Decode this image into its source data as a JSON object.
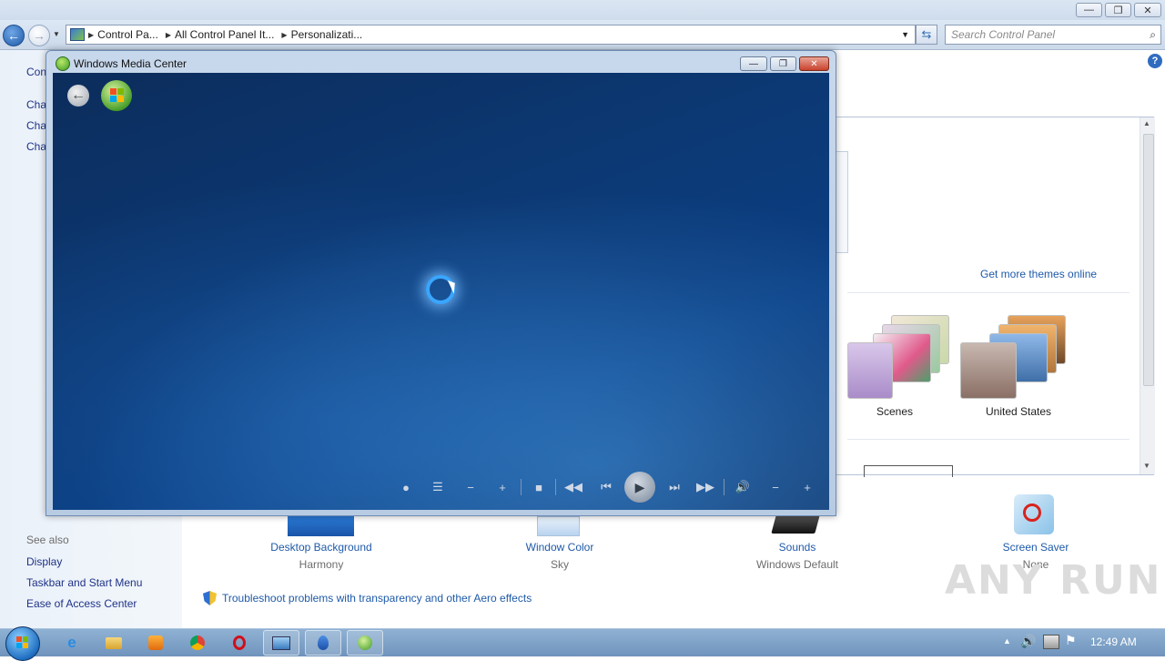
{
  "explorer": {
    "breadcrumb": [
      "Control Pa...",
      "All Control Panel It...",
      "Personalizati..."
    ],
    "search_placeholder": "Search Control Panel"
  },
  "left_pane": {
    "items_partial": [
      "Con",
      "Cha",
      "Cha",
      "Cha"
    ],
    "see_also_label": "See also",
    "see_also": [
      "Display",
      "Taskbar and Start Menu",
      "Ease of Access Center"
    ]
  },
  "themes": {
    "get_more_link": "Get more themes online",
    "items": [
      {
        "label": "Scenes"
      },
      {
        "label": "United States"
      }
    ]
  },
  "bottom_items": [
    {
      "title": "Desktop Background",
      "value": "Harmony"
    },
    {
      "title": "Window Color",
      "value": "Sky"
    },
    {
      "title": "Sounds",
      "value": "Windows Default"
    },
    {
      "title": "Screen Saver",
      "value": "None"
    }
  ],
  "troubleshoot_link": "Troubleshoot problems with transparency and other Aero effects",
  "wmc": {
    "title": "Windows Media Center"
  },
  "taskbar": {
    "clock": "12:49 AM"
  },
  "watermark": "ANY RUN"
}
